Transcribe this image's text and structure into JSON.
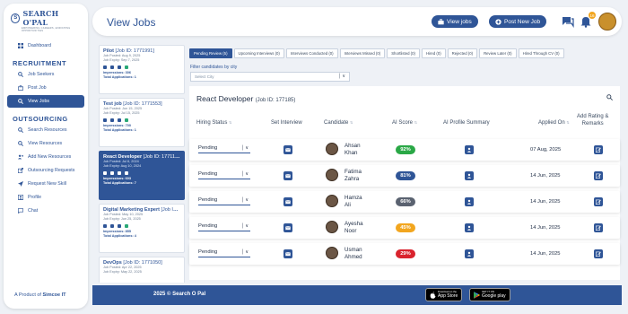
{
  "brand": {
    "logo_letter": "S",
    "name": "SEARCH O'PAL",
    "tagline": "EMPOWERING CAREERS, ENRICHING OPPORTUNITIES",
    "footer_prefix": "A Product of ",
    "footer_company": "Simcoe IT"
  },
  "sidebar": {
    "items": [
      {
        "label": "Dashboard",
        "icon": "dashboard-icon"
      }
    ],
    "recruitment_title": "RECRUITMENT",
    "recruitment": [
      {
        "label": "Job Seekers",
        "icon": "search-icon"
      },
      {
        "label": "Post Job",
        "icon": "briefcase-icon"
      },
      {
        "label": "View Jobs",
        "icon": "search-icon",
        "active": true
      }
    ],
    "outsourcing_title": "OUTSOURCING",
    "outsourcing": [
      {
        "label": "Search Resources",
        "icon": "search-icon"
      },
      {
        "label": "View Resources",
        "icon": "search-icon"
      },
      {
        "label": "Add New Resources",
        "icon": "add-user-icon"
      },
      {
        "label": "Outsourcing Requests",
        "icon": "share-icon"
      },
      {
        "label": "Request New Skill",
        "icon": "send-icon"
      },
      {
        "label": "Profile",
        "icon": "user-icon"
      },
      {
        "label": "Chat",
        "icon": "chat-icon"
      }
    ]
  },
  "header": {
    "title": "View Jobs",
    "view_jobs": "View jobs",
    "post_job": "Post New Job",
    "notif_count": "16"
  },
  "jobs": [
    {
      "title": "Pilot",
      "id": "[Job ID: 1771991]",
      "posted": "Job Posted: Aug 9, 2025",
      "expiry": "Job Expiry: Sep 7, 2025",
      "impressions": "Impressions: 306",
      "applications": "Total Applications: 1"
    },
    {
      "title": "Test job",
      "id": "[Job ID: 1771553]",
      "posted": "Job Posted: Jun 15, 2025",
      "expiry": "Job Expiry: Jul 15, 2025",
      "impressions": "Impressions: 700",
      "applications": "Total Applications: 1"
    },
    {
      "title": "React Developer",
      "id": "[Job ID: 1771185]",
      "posted": "Job Posted: Jul 6, 2024",
      "expiry": "Job Expiry: Aug 10, 2024",
      "impressions": "Impressions: 603",
      "applications": "Total Applications: 7",
      "active": true
    },
    {
      "title": "Digital Marketing Expert",
      "id": "[Job ID: 1771064]",
      "posted": "Job Posted: May 10, 2025",
      "expiry": "Job Expiry: Jun 25, 2025",
      "impressions": "Impressions: 855",
      "applications": "Total Applications: 4"
    },
    {
      "title": "DevOps",
      "id": "[Job ID: 1771050]",
      "posted": "Job Posted: Apr 22, 2025",
      "expiry": "Job Expiry: May 22, 2025",
      "impressions": "",
      "applications": ""
    }
  ],
  "tabs": [
    "Pending Review (5)",
    "Upcoming Interviews (0)",
    "Interviews Conducted (0)",
    "Interviews Missed (0)",
    "Shortlisted (0)",
    "Hired (0)",
    "Rejected (0)",
    "Review Later (0)",
    "Hired Through CV (0)"
  ],
  "filter": {
    "label": "Filter candidates by city",
    "placeholder": "Select City"
  },
  "panel": {
    "title": "React Developer",
    "job_id": "(Job ID: 177185)"
  },
  "columns": {
    "status": "Hiring Status",
    "interview": "Set Interview",
    "candidate": "Candidate",
    "score": "AI Score",
    "summary": "AI Profile Summary",
    "applied": "Applied On",
    "rating1": "Add Rating &",
    "rating2": "Remarks"
  },
  "candidates": [
    {
      "status": "Pending",
      "first": "Ahsan",
      "last": "Khan",
      "score": "92%",
      "score_color": "#2aa846",
      "applied": "07 Aug, 2025"
    },
    {
      "status": "Pending",
      "first": "Fatima",
      "last": "Zahra",
      "score": "81%",
      "score_color": "#2f5597",
      "applied": "14 Jun, 2025"
    },
    {
      "status": "Pending",
      "first": "Hamza",
      "last": "Ali",
      "score": "66%",
      "score_color": "#5a6270",
      "applied": "14 Jun, 2025"
    },
    {
      "status": "Pending",
      "first": "Ayesha",
      "last": "Noor",
      "score": "45%",
      "score_color": "#f2a61f",
      "applied": "14 Jun, 2025"
    },
    {
      "status": "Pending",
      "first": "Usman",
      "last": "Ahmed",
      "score": "29%",
      "score_color": "#d9232d",
      "applied": "14 Jun, 2025"
    }
  ],
  "footer": {
    "copyright": "2025 © Search O Pal",
    "appstore_small": "Download on the",
    "appstore": "App Store",
    "play_small": "GET IT ON",
    "play": "Google play"
  }
}
